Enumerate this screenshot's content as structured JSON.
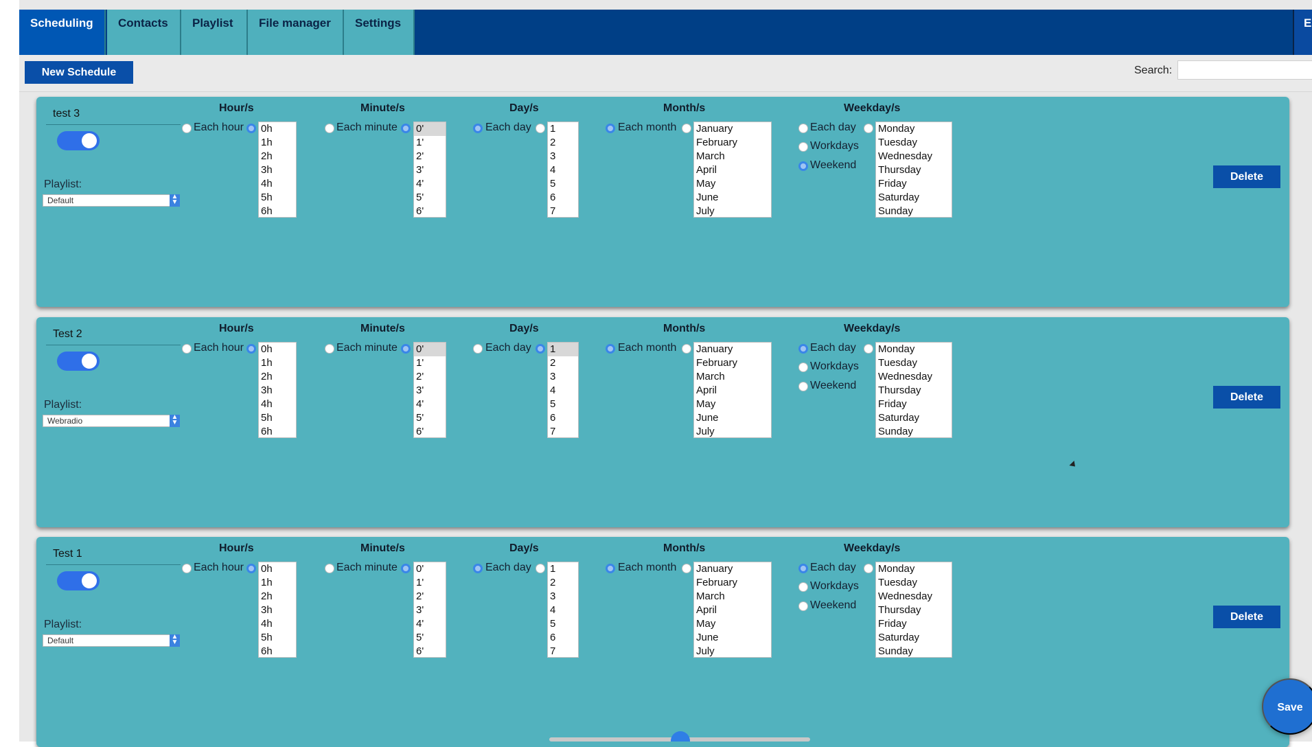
{
  "nav": {
    "tabs": [
      {
        "label": "Scheduling",
        "active": true
      },
      {
        "label": "Contacts",
        "active": false
      },
      {
        "label": "Playlist",
        "active": false
      },
      {
        "label": "File manager",
        "active": false
      },
      {
        "label": "Settings",
        "active": false
      }
    ],
    "overflow_tab_label": "E"
  },
  "toolbar": {
    "new_schedule_label": "New Schedule",
    "search_label": "Search:",
    "search_value": ""
  },
  "labels": {
    "hours": "Hour/s",
    "minutes": "Minute/s",
    "days": "Day/s",
    "months": "Month/s",
    "weekdays": "Weekday/s",
    "each_hour": "Each hour",
    "each_minute": "Each minute",
    "each_day": "Each day",
    "each_month": "Each month",
    "wd_each_day": "Each day",
    "workdays": "Workdays",
    "weekend": "Weekend",
    "playlist": "Playlist:",
    "delete": "Delete"
  },
  "options": {
    "hours": [
      "0h",
      "1h",
      "2h",
      "3h",
      "4h",
      "5h",
      "6h"
    ],
    "minutes": [
      "0'",
      "1'",
      "2'",
      "3'",
      "4'",
      "5'",
      "6'"
    ],
    "days": [
      "1",
      "2",
      "3",
      "4",
      "5",
      "6",
      "7"
    ],
    "months": [
      "January",
      "February",
      "March",
      "April",
      "May",
      "June",
      "July"
    ],
    "weekdays": [
      "Monday",
      "Tuesday",
      "Wednesday",
      "Thursday",
      "Friday",
      "Saturday",
      "Sunday"
    ]
  },
  "schedules": [
    {
      "name": "test 3",
      "enabled": true,
      "playlist": "Default",
      "hour_mode": "specific",
      "minute_mode": "specific",
      "day_mode": "each",
      "month_mode": "each",
      "weekday_mode": "weekend",
      "selected_minute": "0'",
      "selected_day": ""
    },
    {
      "name": "Test 2",
      "enabled": true,
      "playlist": "Webradio",
      "hour_mode": "specific",
      "minute_mode": "specific",
      "day_mode": "specific",
      "month_mode": "each",
      "weekday_mode": "each",
      "selected_minute": "0'",
      "selected_day": "1"
    },
    {
      "name": "Test 1",
      "enabled": true,
      "playlist": "Default",
      "hour_mode": "specific",
      "minute_mode": "specific",
      "day_mode": "each",
      "month_mode": "each",
      "weekday_mode": "each",
      "selected_minute": "",
      "selected_day": ""
    }
  ],
  "save_label": "Save",
  "colors": {
    "nav_bg": "#003f86",
    "tab_active": "#0057b4",
    "tab_inactive": "#4fb0bd",
    "card_bg": "#52b2be",
    "button_bg": "#0a4fa8",
    "toggle_on": "#2f6fe8"
  }
}
